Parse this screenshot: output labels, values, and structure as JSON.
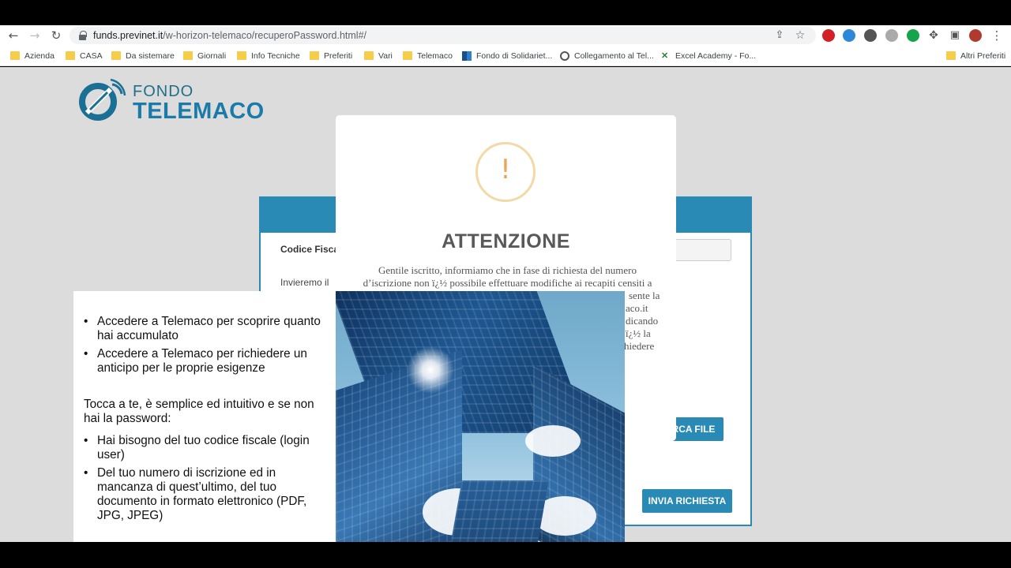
{
  "browser": {
    "url_domain": "funds.previnet.it",
    "url_path": "/w-horizon-telemaco/recuperoPassword.html#/",
    "bookmarks": [
      "Azienda",
      "CASA",
      "Da sistemare",
      "Giornali",
      "Info Tecniche",
      "Preferiti",
      "Vari",
      "Telemaco",
      "Fondo di Solidariet...",
      "Collegamento al Tel...",
      "Excel Academy - Fo..."
    ],
    "other_bookmarks": "Altri Preferiti"
  },
  "logo": {
    "line1": "FONDO",
    "line2": "TELEMACO"
  },
  "form": {
    "codice_fiscale_label": "Codice Fisca",
    "invieremo_text": "Invieremo il",
    "carica_file_button": "RCA FILE",
    "invia_button": "INVIA RICHIESTA"
  },
  "modal": {
    "icon": "!",
    "title": "ATTENZIONE",
    "body_lines": [
      "Gentile iscritto, informiamo che in fase di richiesta del numero",
      "d’iscrizione non ï¿½ possibile effettuare modifiche ai recapiti censiti a",
      "sente la",
      "aco.it",
      "dicando",
      "ï¿½ la",
      "hiedere"
    ]
  },
  "overlay": {
    "list1": [
      "Accedere a Telemaco per scoprire quanto hai accumulato",
      "Accedere a Telemaco per richiedere un anticipo per le proprie esigenze"
    ],
    "paragraph": "Tocca a te, è semplice ed intuitivo e se non hai la password:",
    "list2": [
      "Hai bisogno del tuo codice fiscale (login user)",
      "Del tuo numero di iscrizione ed in mancanza di quest’ultimo, del tuo documento in formato elettronico (PDF, JPG, JPEG)"
    ]
  }
}
